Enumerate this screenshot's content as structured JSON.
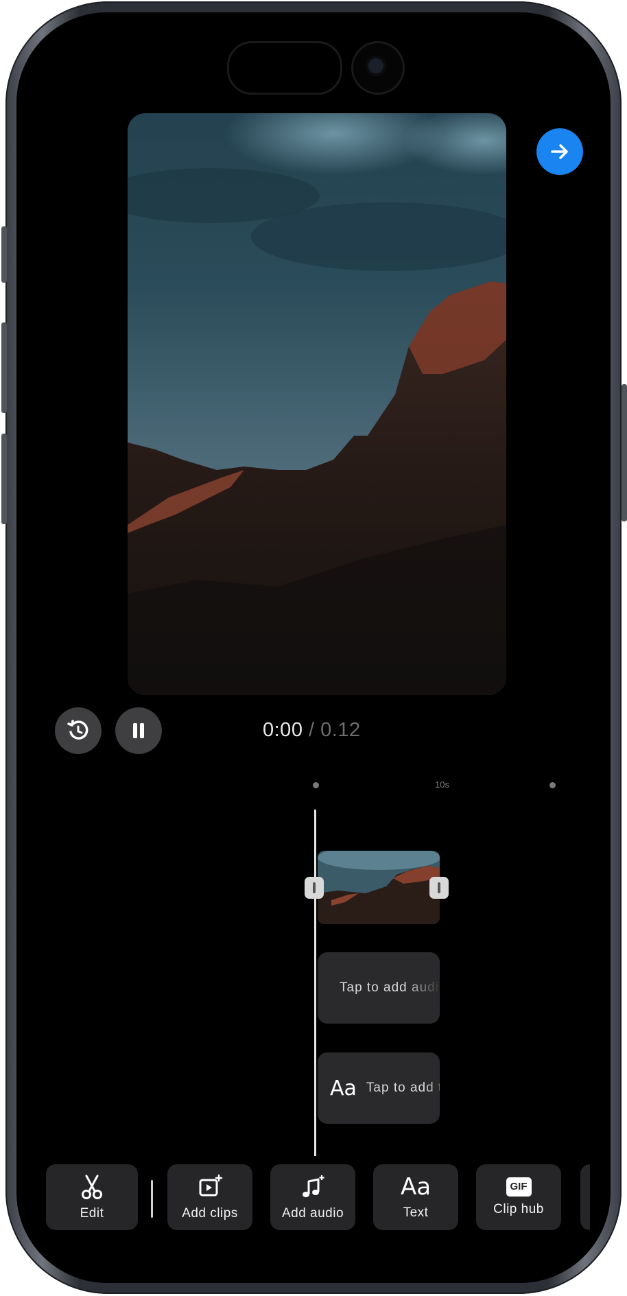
{
  "player": {
    "current_time": "0:00",
    "separator": "/",
    "total_time": "0.12"
  },
  "timeline": {
    "ruler_mark": "10s",
    "audio_track_label": "Tap to add audio",
    "text_track_label": "Tap to add text"
  },
  "toolbar": {
    "items": [
      {
        "label": "Edit",
        "icon": "scissors-icon"
      },
      {
        "label": "Add clips",
        "icon": "add-clip-icon"
      },
      {
        "label": "Add audio",
        "icon": "music-note-icon"
      },
      {
        "label": "Text",
        "icon": "text-aa-icon"
      },
      {
        "label": "Clip hub",
        "icon": "gif-icon",
        "icon_text": "GIF"
      }
    ]
  },
  "colors": {
    "accent": "#1a84f0",
    "background": "#000000",
    "tool_bg": "#262628"
  }
}
